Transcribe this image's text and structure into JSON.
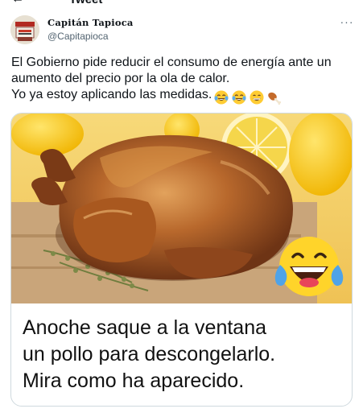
{
  "header": {
    "back_icon": "back-arrow-icon",
    "title": "Tweet"
  },
  "author": {
    "display_name": "Capitán Tapioca",
    "handle": "@Capitapioca",
    "avatar_icon": "avatar-image"
  },
  "tweet": {
    "text": "El Gobierno pide reducir el consumo de energía ante un aumento del precio por la ola de calor.\nYo ya estoy aplicando las medidas.",
    "emojis": [
      "tears-of-joy-emoji",
      "tears-of-joy-emoji",
      "grinning-face-emoji",
      "poultry-leg-emoji"
    ]
  },
  "media": {
    "image_icon": "roast-chicken-photo",
    "overlay_emoji": "laughing-emoji",
    "caption": "Anoche saque a la ventana\nun pollo para descongelarlo.\nMira como ha aparecido."
  },
  "colors": {
    "text": "#0f1419",
    "secondary": "#536471",
    "border": "#cfd9de"
  }
}
